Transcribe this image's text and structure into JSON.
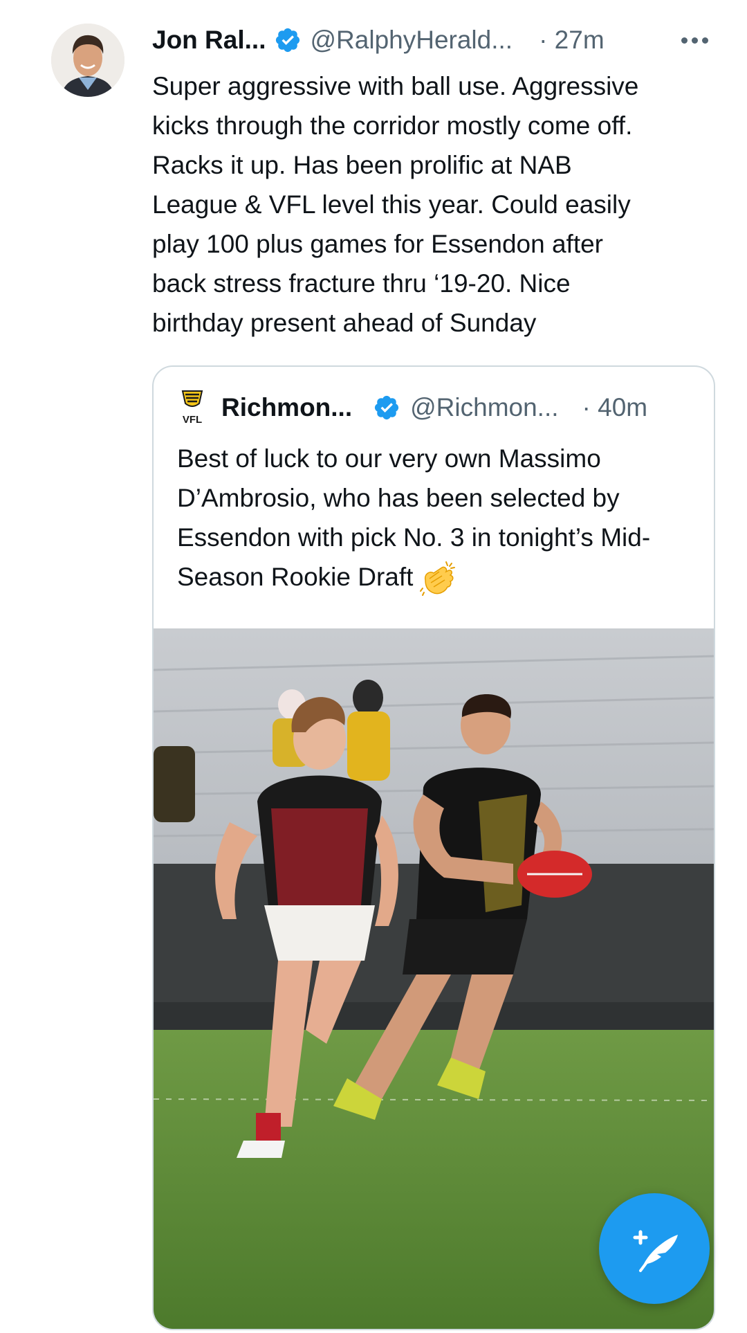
{
  "tweet": {
    "author_name": "Jon Ral...",
    "author_handle": "@RalphyHerald...",
    "time": "· 27m",
    "text": "Super aggressive with ball use. Aggressive\nkicks through the corridor mostly come off.\nRacks it up. Has been prolific at NAB\nLeague & VFL level this year. Could easily\nplay 100 plus games for Essendon after\nback stress fracture thru ‘19-20.  Nice\nbirthday present ahead of Sunday",
    "avatar_icon": "profile-photo-avatar",
    "more_icon": "more-options-icon"
  },
  "quote": {
    "author_name": "Richmon...",
    "author_handle": "@Richmon...",
    "time": "· 40m",
    "logo_text": "VFL",
    "text": "Best of luck to our very own Massimo D’Ambrosio, who has been selected by Essendon with pick No. 3 in tonight’s Mid-Season Rookie Draft",
    "emoji_icon": "clapping-hands-icon",
    "media_description_icon": "football-photo"
  },
  "fab": {
    "icon": "compose-tweet-icon"
  },
  "colors": {
    "brand_blue": "#1d9bf0",
    "text_primary": "#0f1419",
    "text_secondary": "#536471",
    "border": "#cfd9de",
    "verified": "#1d9bf0"
  }
}
